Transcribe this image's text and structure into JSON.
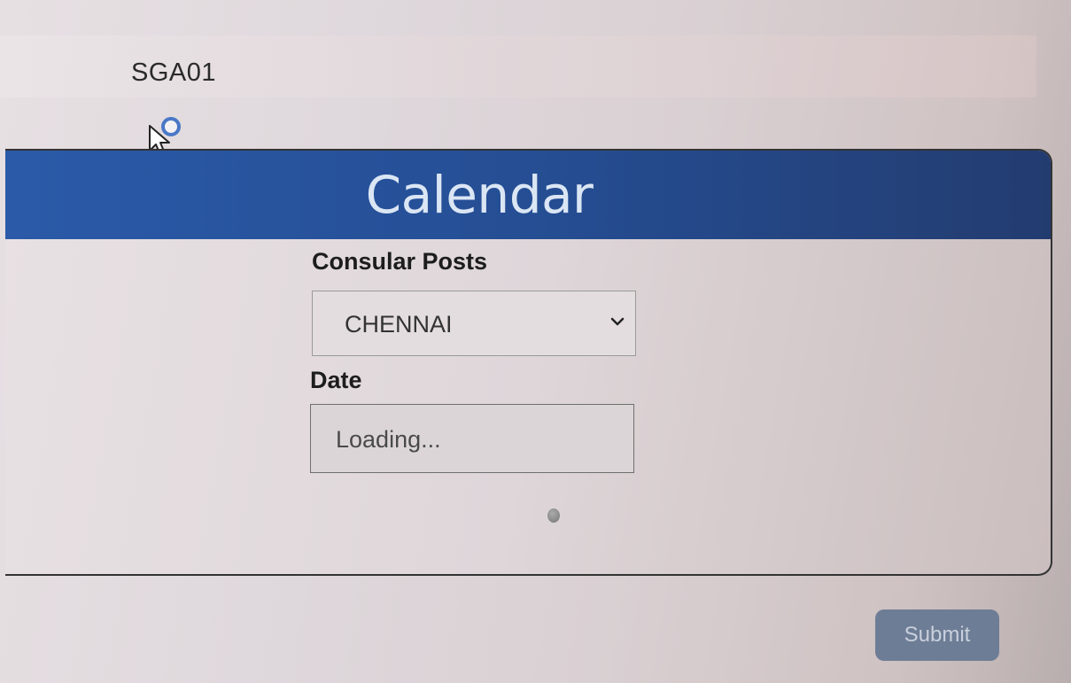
{
  "header": {
    "user_id": "SGA01"
  },
  "calendar": {
    "title": "Calendar",
    "consular_posts_label": "Consular Posts",
    "consular_post_selected": "CHENNAI",
    "date_label": "Date",
    "date_value": "Loading..."
  },
  "actions": {
    "submit_label": "Submit"
  },
  "colors": {
    "header_blue": "#2b5aa8",
    "submit_button": "#6e7d96",
    "busy_ring": "#4a78c6"
  },
  "icons": {
    "cursor": "mouse-pointer-icon",
    "busy": "busy-ring-icon",
    "select_arrow": "chevron-down-icon",
    "loading": "loading-spinner-icon"
  }
}
